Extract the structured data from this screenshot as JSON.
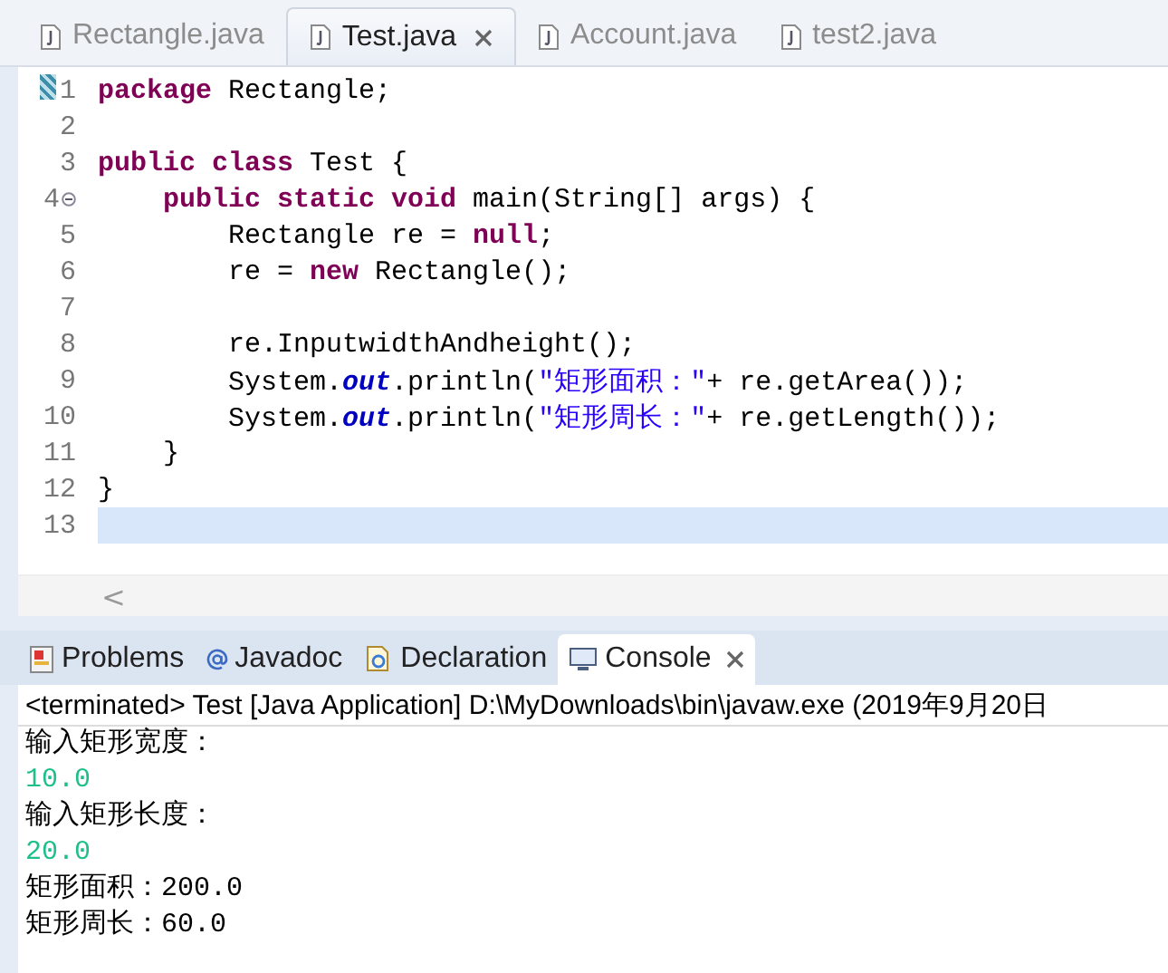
{
  "editor_tabs": [
    {
      "label": "Rectangle.java",
      "selected": false,
      "closable": false
    },
    {
      "label": "Test.java",
      "selected": true,
      "closable": true
    },
    {
      "label": "Account.java",
      "selected": false,
      "closable": false
    },
    {
      "label": "test2.java",
      "selected": false,
      "closable": false
    }
  ],
  "code_lines": [
    {
      "number": "1",
      "current": false,
      "fold_marker": false,
      "tokens": [
        {
          "kind": "keyword",
          "text": "package "
        },
        {
          "kind": "plain",
          "text": "Rectangle;"
        }
      ]
    },
    {
      "number": "2",
      "current": false,
      "fold_marker": false
    },
    {
      "number": "3",
      "current": false,
      "fold_marker": false,
      "tokens": [
        {
          "kind": "keyword",
          "text": "public class "
        },
        {
          "kind": "plain",
          "text": "Test {"
        }
      ]
    },
    {
      "number": "4",
      "current": false,
      "fold_marker": true,
      "tokens": [
        {
          "kind": "keyword",
          "text": "    public static void "
        },
        {
          "kind": "plain",
          "text": "main(String[] args) {"
        }
      ]
    },
    {
      "number": "5",
      "current": false,
      "fold_marker": false,
      "tokens": [
        {
          "kind": "plain",
          "text": "        Rectangle re = "
        },
        {
          "kind": "keyword",
          "text": "null"
        },
        {
          "kind": "plain",
          "text": ";"
        }
      ]
    },
    {
      "number": "6",
      "current": false,
      "fold_marker": false,
      "tokens": [
        {
          "kind": "plain",
          "text": "        re = "
        },
        {
          "kind": "keyword",
          "text": "new"
        },
        {
          "kind": "plain",
          "text": " Rectangle();"
        }
      ]
    },
    {
      "number": "7",
      "current": false,
      "fold_marker": false
    },
    {
      "number": "8",
      "current": false,
      "fold_marker": false,
      "tokens": [
        {
          "kind": "plain",
          "text": "        re.InputwidthAndheight();"
        }
      ]
    },
    {
      "number": "9",
      "current": false,
      "fold_marker": false,
      "tokens": [
        {
          "kind": "plain",
          "text": "        System."
        },
        {
          "kind": "field",
          "text": "out"
        },
        {
          "kind": "plain",
          "text": ".println("
        },
        {
          "kind": "string",
          "text": "\"矩形面积：\""
        },
        {
          "kind": "plain",
          "text": "+ re.getArea());"
        }
      ]
    },
    {
      "number": "10",
      "current": false,
      "fold_marker": false,
      "tokens": [
        {
          "kind": "plain",
          "text": "        System."
        },
        {
          "kind": "field",
          "text": "out"
        },
        {
          "kind": "plain",
          "text": ".println("
        },
        {
          "kind": "string",
          "text": "\"矩形周长：\""
        },
        {
          "kind": "plain",
          "text": "+ re.getLength());"
        }
      ]
    },
    {
      "number": "11",
      "current": false,
      "fold_marker": false,
      "tokens": [
        {
          "kind": "plain",
          "text": "    }"
        }
      ]
    },
    {
      "number": "12",
      "current": false,
      "fold_marker": false,
      "tokens": [
        {
          "kind": "plain",
          "text": "}"
        }
      ]
    },
    {
      "number": "13",
      "current": true,
      "fold_marker": false
    }
  ],
  "scroll_left": "<",
  "panel_tabs": [
    {
      "label": "Problems",
      "kind": "problems",
      "selected": false,
      "closable": false
    },
    {
      "label": "Javadoc",
      "kind": "javadoc",
      "selected": false,
      "closable": false
    },
    {
      "label": "Declaration",
      "kind": "declaration",
      "selected": false,
      "closable": false
    },
    {
      "label": "Console",
      "kind": "console",
      "selected": true,
      "closable": true
    }
  ],
  "console_header": "<terminated> Test [Java Application] D:\\MyDownloads\\bin\\javaw.exe (2019年9月20日",
  "console_lines": [
    {
      "kind": "output",
      "text": "输入矩形宽度："
    },
    {
      "kind": "input",
      "text": "10.0"
    },
    {
      "kind": "output",
      "text": "输入矩形长度："
    },
    {
      "kind": "input",
      "text": "20.0"
    },
    {
      "kind": "output",
      "text": "矩形面积：200.0"
    },
    {
      "kind": "output",
      "text": "矩形周长：60.0"
    }
  ]
}
